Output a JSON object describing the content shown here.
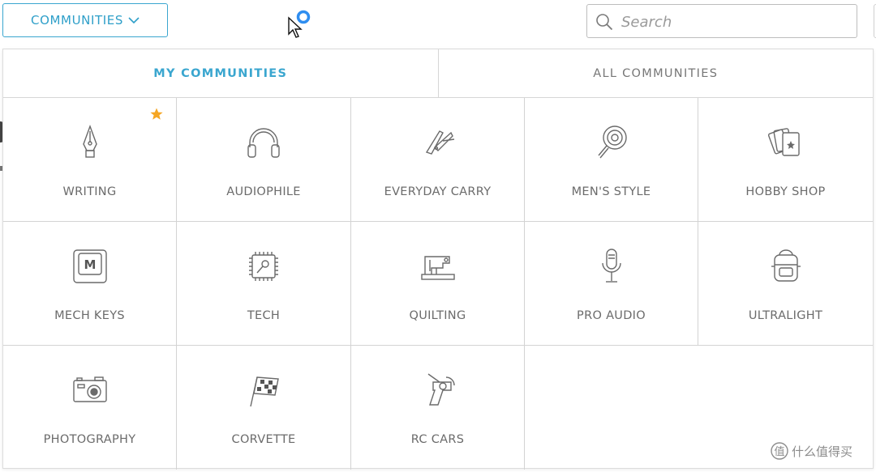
{
  "header": {
    "communities_label": "COMMUNITIES",
    "search_placeholder": "Search"
  },
  "tabs": [
    {
      "label": "MY COMMUNITIES",
      "active": true
    },
    {
      "label": "ALL COMMUNITIES",
      "active": false
    }
  ],
  "communities": [
    {
      "label": "WRITING",
      "icon": "fountain-pen-icon",
      "favorite": true
    },
    {
      "label": "AUDIOPHILE",
      "icon": "headphones-icon"
    },
    {
      "label": "EVERYDAY CARRY",
      "icon": "pocket-knife-icon"
    },
    {
      "label": "MEN'S STYLE",
      "icon": "watch-icon"
    },
    {
      "label": "HOBBY SHOP",
      "icon": "playing-cards-icon"
    },
    {
      "label": "MECH KEYS",
      "icon": "keycap-icon"
    },
    {
      "label": "TECH",
      "icon": "microchip-icon"
    },
    {
      "label": "QUILTING",
      "icon": "sewing-machine-icon"
    },
    {
      "label": "PRO AUDIO",
      "icon": "microphone-icon"
    },
    {
      "label": "ULTRALIGHT",
      "icon": "backpack-icon"
    },
    {
      "label": "PHOTOGRAPHY",
      "icon": "camera-icon"
    },
    {
      "label": "CORVETTE",
      "icon": "checkered-flag-icon"
    },
    {
      "label": "RC CARS",
      "icon": "rc-controller-icon"
    }
  ],
  "colors": {
    "accent": "#3aa6cf",
    "favorite": "#f5a623"
  },
  "watermark": {
    "text": "什么值得买"
  }
}
